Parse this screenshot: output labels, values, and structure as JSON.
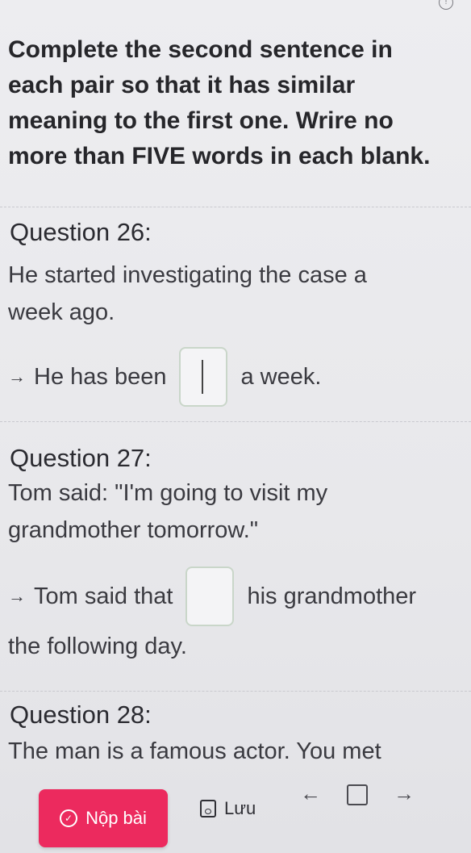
{
  "instructions": {
    "line1": "Complete the second sentence in",
    "line2": "each pair so that it has similar",
    "line3": "meaning to the first one. Wrire no",
    "line4": "more than FIVE words in each blank."
  },
  "questions": [
    {
      "title": "Question 26:",
      "text_line1": "He started investigating the case a",
      "text_line2": "week ago.",
      "arrow": "→",
      "answer_before": "He has been",
      "answer_after": "a week.",
      "answer_value": ""
    },
    {
      "title": "Question 27:",
      "text_line1": "Tom said: \"I'm going to visit my",
      "text_line2": "grandmother tomorrow.\"",
      "arrow": "→",
      "answer_before": "Tom said that",
      "answer_after": "his grandmother",
      "answer_continuation": "the following day.",
      "answer_value": ""
    },
    {
      "title": "Question 28:",
      "text_line1": "The man is a famous actor. You met"
    }
  ],
  "toolbar": {
    "submit_label": "Nộp bài",
    "submit_icon": "check-circle-icon",
    "save_label": "Lưu",
    "save_icon": "save-icon",
    "prev_arrow": "←",
    "next_arrow": "→",
    "accent_color": "#ec2a5e"
  }
}
